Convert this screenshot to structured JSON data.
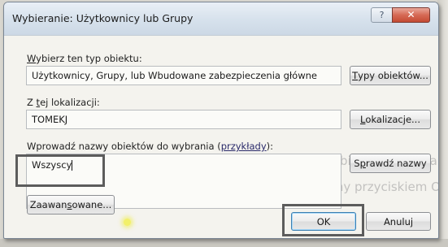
{
  "window": {
    "title": "Wybieranie: Użytkownicy lub Grupy",
    "help_glyph": "?",
    "close_glyph": "✕"
  },
  "object_type": {
    "label_prefix": "W",
    "label_rest": "ybierz ten typ obiektu:",
    "value": "Użytkownicy, Grupy, lub Wbudowane zabezpieczenia główne",
    "button_prefix": "T",
    "button_rest": "ypy obiektów..."
  },
  "location": {
    "label_a": "Z ",
    "label_ul": "t",
    "label_b": "ej lokalizacji:",
    "value": "TOMEKJ",
    "button_prefix": "L",
    "button_rest": "okalizacje..."
  },
  "object_names": {
    "label": "Wprowadź nazwy obiektów do wybrania (",
    "examples_link": "przykłady",
    "label_end": "):",
    "value": "Wszyscy",
    "check_button_a": "S",
    "check_button_ul": "p",
    "check_button_b": "rawdź nazwy"
  },
  "footer": {
    "advanced_a": "Zaawan",
    "advanced_ul": "s",
    "advanced_b": "owane...",
    "ok_label": "OK",
    "cancel_label": "Anuluj"
  },
  "background": {
    "text_line1": "sobieraj ani ozona",
    "text_line2": "ateryzowany przyciskiem OK."
  },
  "colors": {
    "highlight_border": "#5c5c5c",
    "close_button": "#d66a55",
    "dialog_background": "#f4f3ee"
  }
}
